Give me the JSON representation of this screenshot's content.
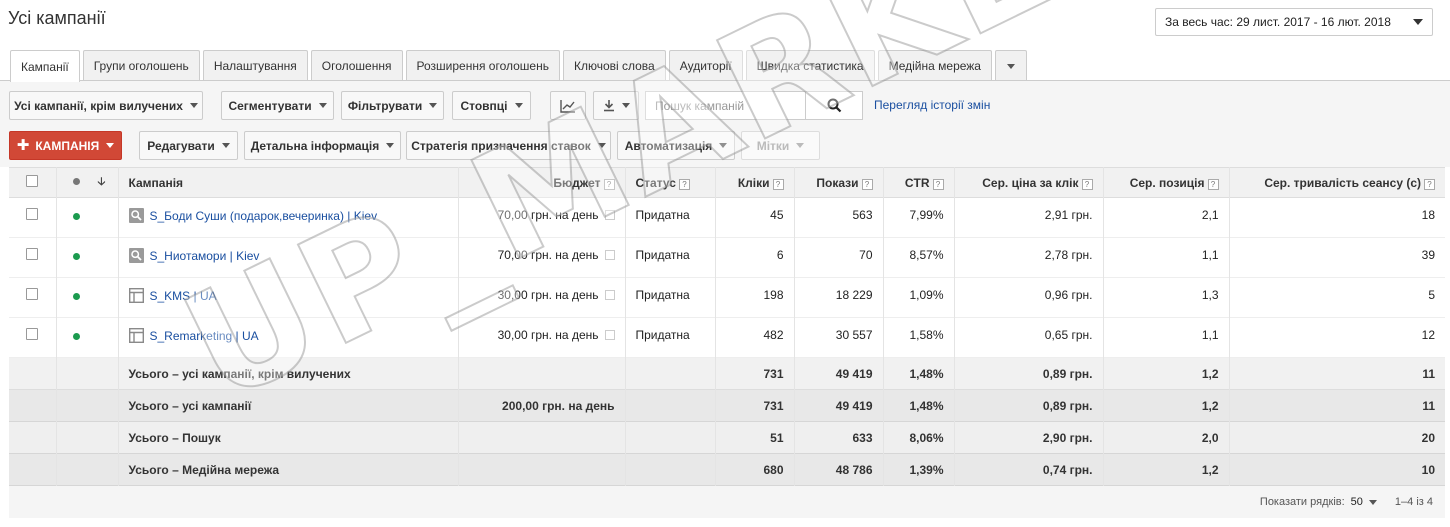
{
  "page": {
    "title": "Усі кампанії",
    "date_range": "За весь час: 29 лист. 2017 - 16 лют. 2018"
  },
  "tabs": [
    {
      "label": "Кампанії",
      "active": true
    },
    {
      "label": "Групи оголошень"
    },
    {
      "label": "Налаштування"
    },
    {
      "label": "Оголошення"
    },
    {
      "label": "Розширення оголошень"
    },
    {
      "label": "Ключові слова"
    },
    {
      "label": "Аудиторії"
    },
    {
      "label": "Швидка статистика"
    },
    {
      "label": "Медійна мережа"
    }
  ],
  "toolbar1": {
    "filter_label": "Усі кампанії, крім вилучених",
    "segment_label": "Сегментувати",
    "filters_label": "Фільтрувати",
    "columns_label": "Стовпці",
    "search_placeholder": "Пошук кампаній",
    "history_link": "Перегляд історії змін"
  },
  "toolbar2": {
    "campaign_btn": "КАМПАНІЯ",
    "edit_btn": "Редагувати",
    "details_btn": "Детальна інформація",
    "bid_strategy_btn": "Стратегія призначення ставок",
    "automation_btn": "Автоматизація",
    "labels_btn": "Мітки"
  },
  "table": {
    "headers": {
      "campaign": "Кампанія",
      "budget": "Бюджет",
      "status": "Статус",
      "clicks": "Кліки",
      "impressions": "Покази",
      "ctr": "CTR",
      "avg_cpc": "Сер. ціна за клік",
      "avg_pos": "Сер. позиція",
      "avg_session": "Сер. тривалість сеансу (с)"
    },
    "rows": [
      {
        "name": "S_Боди Суши (подарок,вечеринка) | Kiev",
        "type": "search",
        "budget": "70,00 грн. на день",
        "status": "Придатна",
        "clicks": "45",
        "impressions": "563",
        "ctr": "7,99%",
        "avg_cpc": "2,91 грн.",
        "avg_pos": "2,1",
        "avg_session": "18"
      },
      {
        "name": "S_Ниотамори | Kiev",
        "type": "search",
        "budget": "70,00 грн. на день",
        "status": "Придатна",
        "clicks": "6",
        "impressions": "70",
        "ctr": "8,57%",
        "avg_cpc": "2,78 грн.",
        "avg_pos": "1,1",
        "avg_session": "39"
      },
      {
        "name": "S_KMS | UA",
        "type": "display",
        "budget": "30,00 грн. на день",
        "status": "Придатна",
        "clicks": "198",
        "impressions": "18 229",
        "ctr": "1,09%",
        "avg_cpc": "0,96 грн.",
        "avg_pos": "1,3",
        "avg_session": "5"
      },
      {
        "name": "S_Remarketing | UA",
        "type": "display",
        "budget": "30,00 грн. на день",
        "status": "Придатна",
        "clicks": "482",
        "impressions": "30 557",
        "ctr": "1,58%",
        "avg_cpc": "0,65 грн.",
        "avg_pos": "1,1",
        "avg_session": "12"
      }
    ],
    "totals": [
      {
        "label": "Усього – усі кампанії, крім вилучених",
        "budget": "",
        "clicks": "731",
        "impressions": "49 419",
        "ctr": "1,48%",
        "avg_cpc": "0,89 грн.",
        "avg_pos": "1,2",
        "avg_session": "11"
      },
      {
        "label": "Усього – усі кампанії",
        "budget": "200,00 грн. на день",
        "clicks": "731",
        "impressions": "49 419",
        "ctr": "1,48%",
        "avg_cpc": "0,89 грн.",
        "avg_pos": "1,2",
        "avg_session": "11"
      },
      {
        "label": "Усього – Пошук",
        "budget": "",
        "clicks": "51",
        "impressions": "633",
        "ctr": "8,06%",
        "avg_cpc": "2,90 грн.",
        "avg_pos": "2,0",
        "avg_session": "20"
      },
      {
        "label": "Усього – Медійна мережа",
        "budget": "",
        "clicks": "680",
        "impressions": "48 786",
        "ctr": "1,39%",
        "avg_cpc": "0,74 грн.",
        "avg_pos": "1,2",
        "avg_session": "10"
      }
    ]
  },
  "footer": {
    "rows_label": "Показати рядків:",
    "rows_value": "50",
    "range": "1–4 із 4"
  },
  "watermark": "UP_MARKETING"
}
